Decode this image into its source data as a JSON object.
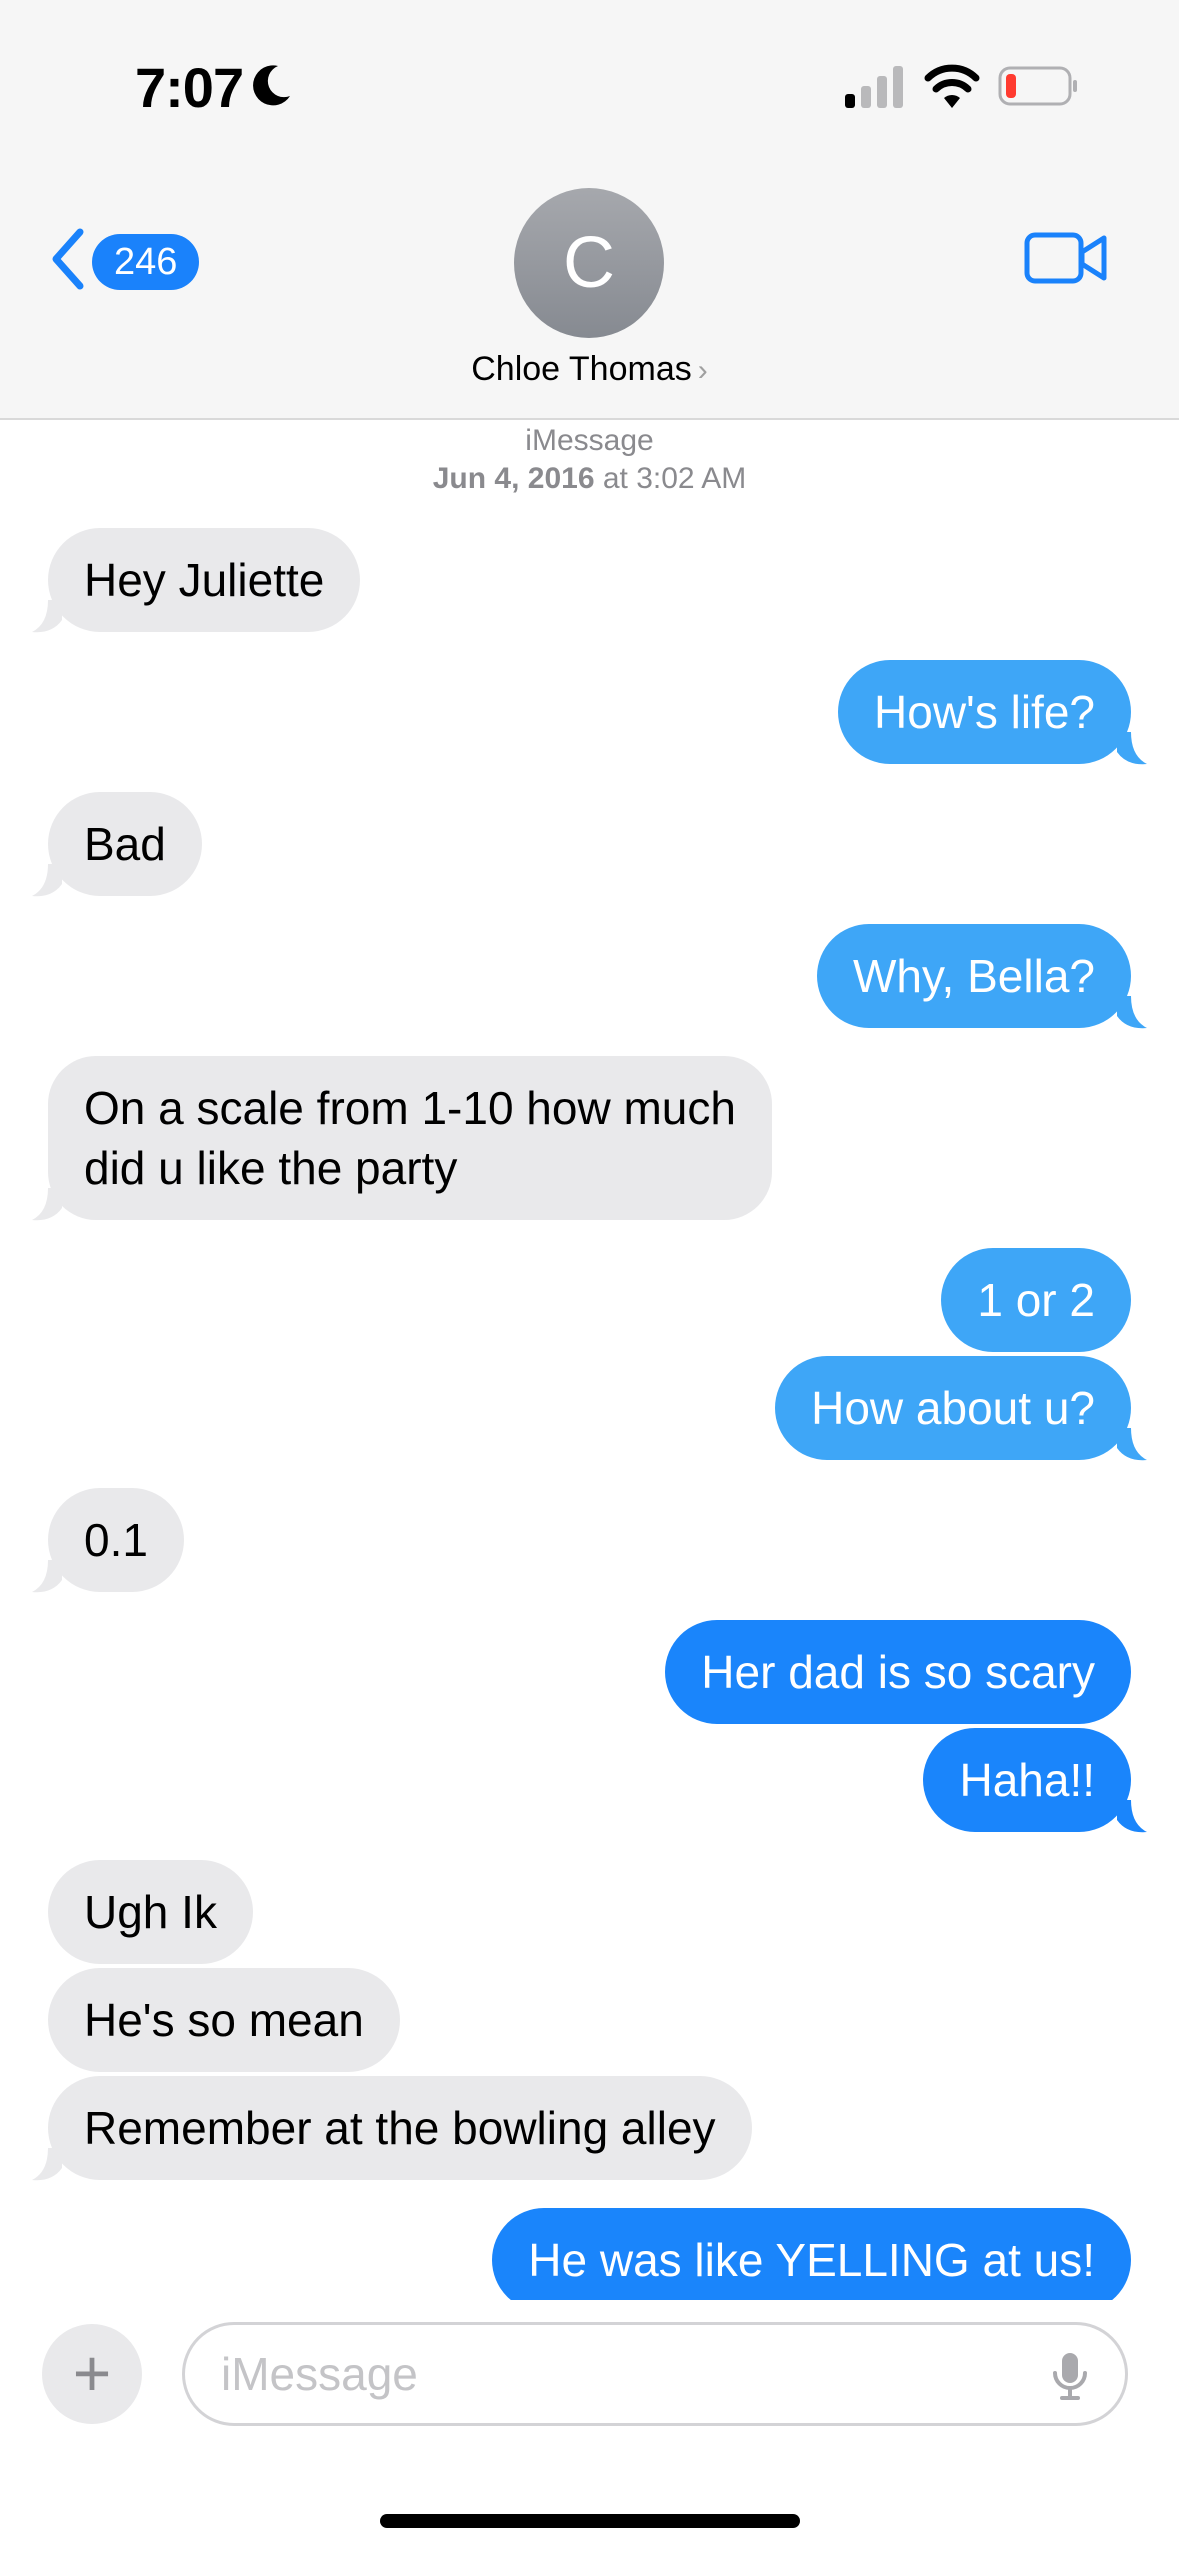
{
  "status": {
    "time": "7:07"
  },
  "nav": {
    "back_count": "246",
    "avatar_initial": "C",
    "contact_name": "Chloe Thomas"
  },
  "thread": {
    "service": "iMessage",
    "date_bold": "Jun 4, 2016",
    "date_rest": " at 3:02 AM"
  },
  "messages": [
    {
      "dir": "in",
      "text": "Hey Juliette"
    },
    {
      "dir": "out",
      "text": "How's life?"
    },
    {
      "dir": "in",
      "text": "Bad"
    },
    {
      "dir": "out",
      "text": "Why, Bella?"
    },
    {
      "dir": "in",
      "text": "On a scale from 1-10 how much",
      "text2": "did u like the party"
    },
    {
      "dir": "out",
      "text": "1 or 2"
    },
    {
      "dir": "out",
      "text": "How about u?"
    },
    {
      "dir": "in",
      "text": "0.1"
    },
    {
      "dir": "out",
      "text": "Her dad is so scary"
    },
    {
      "dir": "out",
      "text": "Haha!!"
    },
    {
      "dir": "in",
      "text": "Ugh Ik"
    },
    {
      "dir": "in",
      "text": "He's so mean"
    },
    {
      "dir": "in",
      "text": "Remember at the bowling alley"
    },
    {
      "dir": "out",
      "text": "He was like YELLING at us!"
    }
  ],
  "composer": {
    "placeholder": "iMessage"
  },
  "colors": {
    "incoming": "#e9e9eb",
    "outgoing": "#1a85fb",
    "outgoing_light": "#3ea6f7",
    "accent": "#1a82fb"
  }
}
